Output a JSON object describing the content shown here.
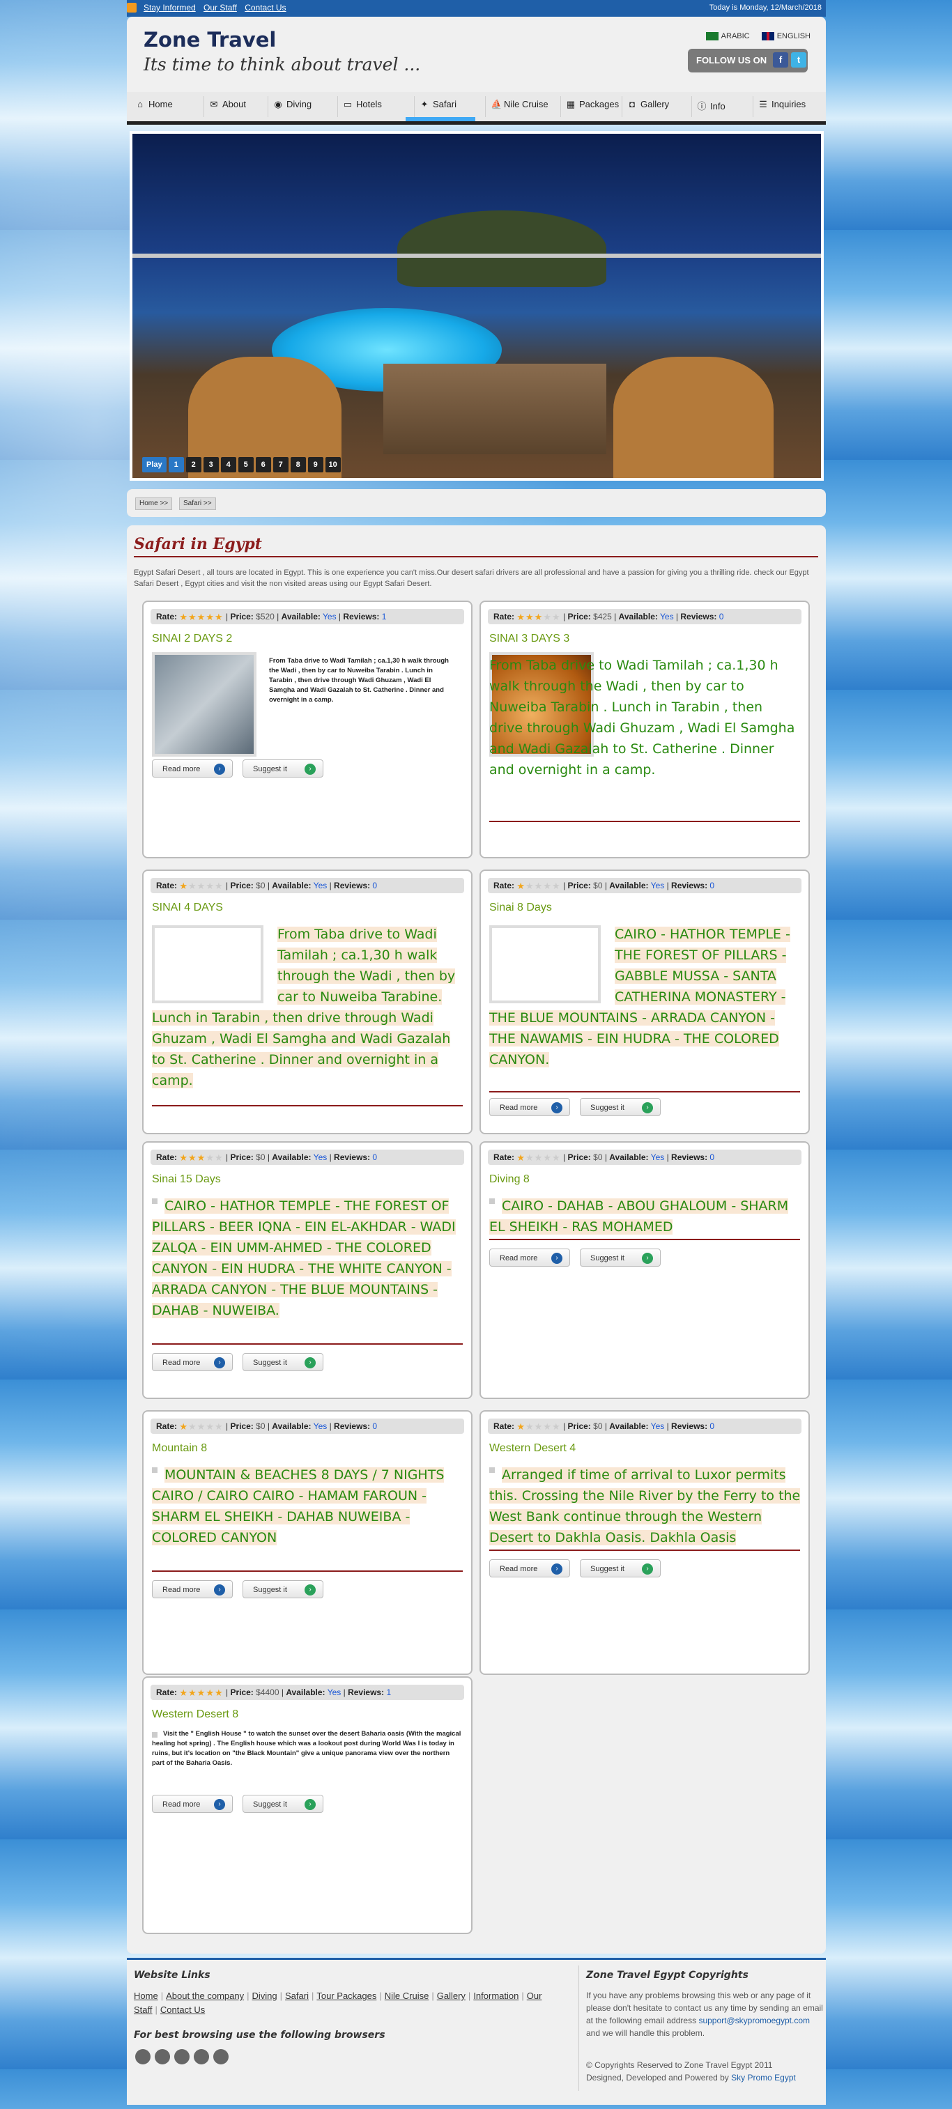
{
  "topbar": {
    "links": [
      "Stay Informed",
      "Our Staff",
      "Contact Us"
    ],
    "date": "Today is Monday, 12/March/2018"
  },
  "header": {
    "title": "Zone Travel",
    "tagline": "Its time to think about travel ...",
    "lang_arabic": "ARABIC",
    "lang_english": "ENGLISH",
    "follow_us": "FOLLOW US ON"
  },
  "nav": {
    "items": [
      {
        "label": "Home",
        "icon": "home-icon"
      },
      {
        "label": "About",
        "icon": "speech-bubble-icon"
      },
      {
        "label": "Diving",
        "icon": "mask-icon"
      },
      {
        "label": "Hotels",
        "icon": "bed-icon"
      },
      {
        "label": "Safari",
        "icon": "compass-icon"
      },
      {
        "label": "Nile Cruise",
        "icon": "boat-icon"
      },
      {
        "label": "Packages",
        "icon": "package-icon"
      },
      {
        "label": "Gallery",
        "icon": "camera-icon"
      },
      {
        "label": "Info",
        "icon": "info-icon"
      },
      {
        "label": "Inquiries",
        "icon": "list-icon"
      }
    ],
    "active": "Safari"
  },
  "slider": {
    "play": "Play",
    "pages": [
      "1",
      "2",
      "3",
      "4",
      "5",
      "6",
      "7",
      "8",
      "9",
      "10"
    ],
    "current": "1"
  },
  "breadcrumb": [
    "Home >>",
    "Safari >>"
  ],
  "page": {
    "title": "Safari in Egypt",
    "intro": "Egypt Safari Desert , all tours are located in Egypt. This is one experience you can't miss.Our desert safari drivers are all professional and have a passion for giving you a thrilling ride. check our Egypt Safari Desert , Egypt cities and visit the non visited areas using our Egypt Safari Desert."
  },
  "labels": {
    "rate": "Rate:",
    "price": "Price:",
    "available": "Available:",
    "reviews": "Reviews:",
    "read_more": "Read more",
    "suggest": "Suggest it"
  },
  "tours": [
    {
      "title": "SINAI 2 DAYS 2",
      "stars": 5,
      "price": "$520",
      "available": "Yes",
      "reviews": "1",
      "desc": "From Taba drive to Wadi Tamilah ; ca.1,30 h walk through the Wadi , then by car to Nuweiba Tarabin . Lunch in Tarabin , then drive through Wadi Ghuzam , Wadi El Samgha and Wadi Gazalah to St. Catherine . Dinner and overnight in a camp."
    },
    {
      "title": "SINAI 3 DAYS 3",
      "stars": 3,
      "price": "$425",
      "available": "Yes",
      "reviews": "0",
      "desc": "From Taba drive to Wadi Tamilah ; ca.1,30 h walk through the Wadi , then by car to Nuweiba Tarabin . Lunch in Tarabin , then drive through Wadi Ghuzam , Wadi El Samgha and Wadi Gazalah to St. Catherine . Dinner and overnight in a camp."
    },
    {
      "title": "SINAI 4 DAYS",
      "stars": 1,
      "price": "$0",
      "available": "Yes",
      "reviews": "0",
      "desc": "From Taba drive to Wadi Tamilah ; ca.1,30 h walk through the Wadi , then by car to Nuweiba Tarabine. Lunch in Tarabin , then drive through Wadi Ghuzam , Wadi El Samgha and Wadi Gazalah to St. Catherine . Dinner and overnight in a camp."
    },
    {
      "title": "Sinai 8 Days",
      "stars": 1,
      "price": "$0",
      "available": "Yes",
      "reviews": "0",
      "desc": "CAIRO - HATHOR TEMPLE - THE FOREST OF PILLARS - GABBLE MUSSA - SANTA CATHERINA MONASTERY - THE BLUE MOUNTAINS - ARRADA CANYON - THE NAWAMIS - EIN HUDRA - THE COLORED CANYON."
    },
    {
      "title": "Sinai 15 Days",
      "stars": 3,
      "price": "$0",
      "available": "Yes",
      "reviews": "0",
      "desc": "CAIRO - HATHOR TEMPLE - THE FOREST OF PILLARS - BEER IQNA - EIN EL-AKHDAR - WADI ZALQA - EIN UMM-AHMED - THE COLORED CANYON - EIN HUDRA - THE WHITE CANYON - ARRADA CANYON - THE BLUE MOUNTAINS - DAHAB - NUWEIBA."
    },
    {
      "title": "Diving 8",
      "stars": 1,
      "price": "$0",
      "available": "Yes",
      "reviews": "0",
      "desc": "CAIRO - DAHAB - ABOU GHALOUM - SHARM EL SHEIKH - RAS MOHAMED"
    },
    {
      "title": "Mountain 8",
      "stars": 1,
      "price": "$0",
      "available": "Yes",
      "reviews": "0",
      "desc": "MOUNTAIN & BEACHES 8 DAYS / 7 NIGHTS CAIRO / CAIRO CAIRO - HAMAM FAROUN - SHARM EL SHEIKH - DAHAB NUWEIBA - COLORED CANYON"
    },
    {
      "title": "Western Desert 4",
      "stars": 1,
      "price": "$0",
      "available": "Yes",
      "reviews": "0",
      "desc": "Arranged if time of arrival to Luxor permits this. Crossing the Nile River by the Ferry to the West Bank continue through the Western Desert to Dakhla Oasis. Dakhla Oasis"
    },
    {
      "title": "Western Desert 8",
      "stars": 5,
      "price": "$4400",
      "available": "Yes",
      "reviews": "1",
      "desc": "Visit the \" English House \" to watch the sunset over the desert Baharia oasis (With the magical healing hot spring) . The English house which was a lookout post during World Was I is today in ruins, but it's location on \"the Black Mountain\" give a unique panorama view over the northern part of the Baharia Oasis."
    }
  ],
  "footer": {
    "links_title": "Website Links",
    "links": [
      "Home",
      "About the company",
      "Diving",
      "Safari",
      "Tour Packages",
      "Nile Cruise",
      "Gallery",
      "Information",
      "Our Staff",
      "Contact Us"
    ],
    "browsers_title": "For best browsing use the following browsers",
    "copyright_title": "Zone Travel Egypt Copyrights",
    "contact_text_1": "If you have any problems browsing this web or any page of it please don't hesitate to contact us any time by sending an email at the following email address",
    "email": "support@skypromoegypt.com",
    "contact_text_2": "and we will handle this problem.",
    "copyright_line": "© Copyrights Reserved to Zone Travel Egypt 2011",
    "designed_by": "Designed, Developed and Powered by",
    "designer": "Sky Promo Egypt"
  },
  "colors": {
    "brand_blue": "#1f5fa8",
    "title_red": "#8b1b1b",
    "tour_green": "#6a9a12",
    "desc_green": "#2a8a10",
    "desc_bg": "#f9e7d4",
    "star": "#f2a51b"
  }
}
